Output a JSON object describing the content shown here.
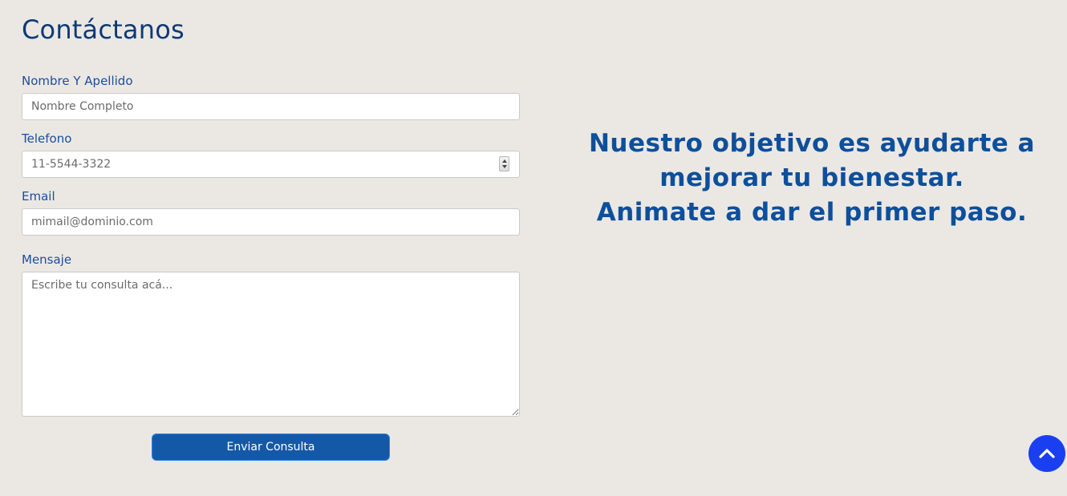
{
  "page": {
    "title": "Contáctanos"
  },
  "form": {
    "name": {
      "label": "Nombre Y Apellido",
      "placeholder": "Nombre Completo"
    },
    "phone": {
      "label": "Telefono",
      "placeholder": "11-5544-3322"
    },
    "email": {
      "label": "Email",
      "placeholder": "mimail@dominio.com"
    },
    "message": {
      "label": "Mensaje",
      "placeholder": "Escribe tu consulta acá..."
    },
    "submit_label": "Enviar Consulta"
  },
  "tagline": {
    "line1": "Nuestro objetivo es ayudarte a",
    "line2": "mejorar tu bienestar.",
    "line3": "Animate a dar el primer paso."
  },
  "icons": {
    "scroll_top": "chevron-up-icon"
  },
  "colors": {
    "background": "#ebe8e4",
    "primary": "#1459a8",
    "heading": "#0e4f9c",
    "scroll_top": "#1a3ff0"
  }
}
